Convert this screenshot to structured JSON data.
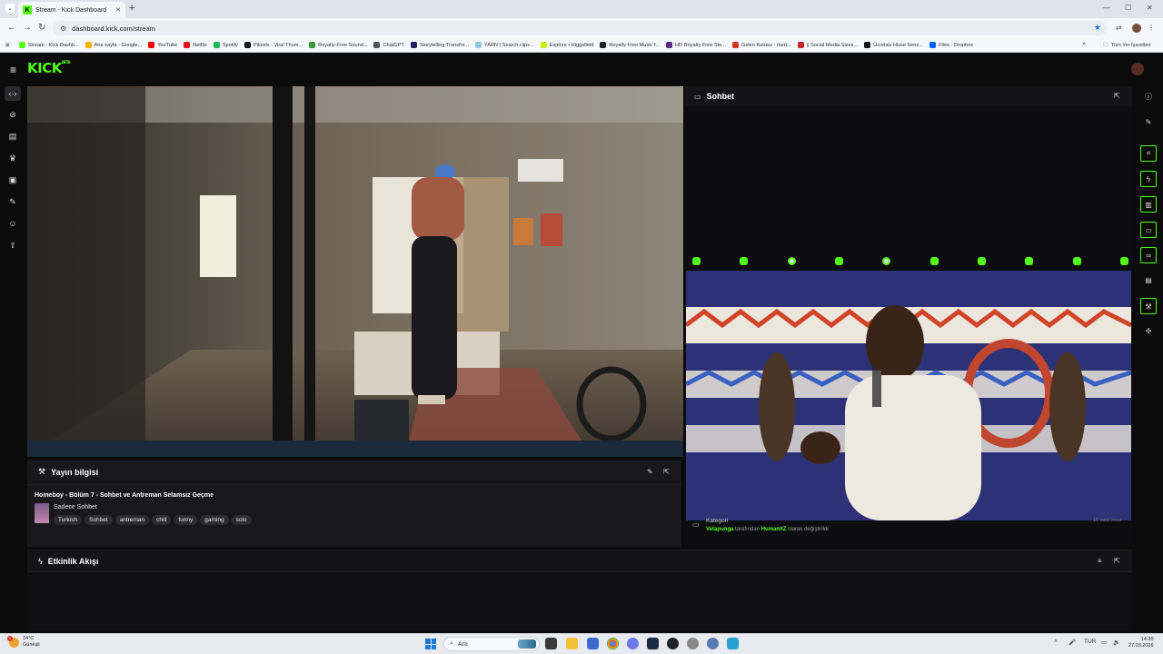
{
  "browser": {
    "tab_title": "Stream - Kick Dashboard",
    "tab_favicon": "K",
    "url": "dashboard.kick.com/stream",
    "bookmarks": [
      {
        "label": "Stream - Kick Dashb...",
        "color": "#53fc18"
      },
      {
        "label": "Ana sayfa - Google...",
        "color": "#f4b400"
      },
      {
        "label": "YouTube",
        "color": "#ff0000"
      },
      {
        "label": "Netflix",
        "color": "#e50914"
      },
      {
        "label": "Spotify",
        "color": "#1db954"
      },
      {
        "label": "Pikzels - Viral Thum...",
        "color": "#111111"
      },
      {
        "label": "Royalty-Free Sound...",
        "color": "#3a9a3a"
      },
      {
        "label": "ChatGPT",
        "color": "#555555"
      },
      {
        "label": "Storytelling Transfor...",
        "color": "#222266"
      },
      {
        "label": "YARN | Search clips...",
        "color": "#8ecae6"
      },
      {
        "label": "Explore • Higgsfield",
        "color": "#c7f000"
      },
      {
        "label": "Royalty Free Music f...",
        "color": "#222222"
      },
      {
        "label": "HD Royalty Free Sto...",
        "color": "#5b2a86"
      },
      {
        "label": "Gelen Kutusu - mert...",
        "color": "#d93025"
      },
      {
        "label": "|| Social Media Sizes...",
        "color": "#c62828"
      },
      {
        "label": "Ücretsiz Hisse Sene...",
        "color": "#111111"
      },
      {
        "label": "Files - Dropbox",
        "color": "#0061ff"
      }
    ],
    "bookmarks_more": "»",
    "all_bookmarks": "Tüm Yer İşaretleri"
  },
  "kick": {
    "logo": "KICK",
    "logo_badge": "BETA"
  },
  "stream_info": {
    "heading": "Yayın bilgisi",
    "title": "Homeboy - Bölüm 7 - Sohbet ve Antreman Selamsız Geçme",
    "category": "Sadece Sohbet",
    "tags": [
      "Turkish",
      "Sohbet",
      "antreman",
      "chill",
      "funny",
      "gaming",
      "solo"
    ]
  },
  "chat": {
    "heading": "Sohbet",
    "event_label": "Kategori",
    "event_user": "Vetapunga",
    "event_middle": " tarafından ",
    "event_target": "HumanitZ",
    "event_end": " olarak değiştirildi",
    "event_time": "16 saat önce"
  },
  "activity": {
    "heading": "Etkinlik Akışı"
  },
  "taskbar": {
    "weather_temp": "14°C",
    "weather_desc": "Güneşli",
    "weather_badge": "1",
    "search_placeholder": "Ara",
    "lang": "TUR",
    "time": "14:30",
    "date": "27.03.2026"
  }
}
